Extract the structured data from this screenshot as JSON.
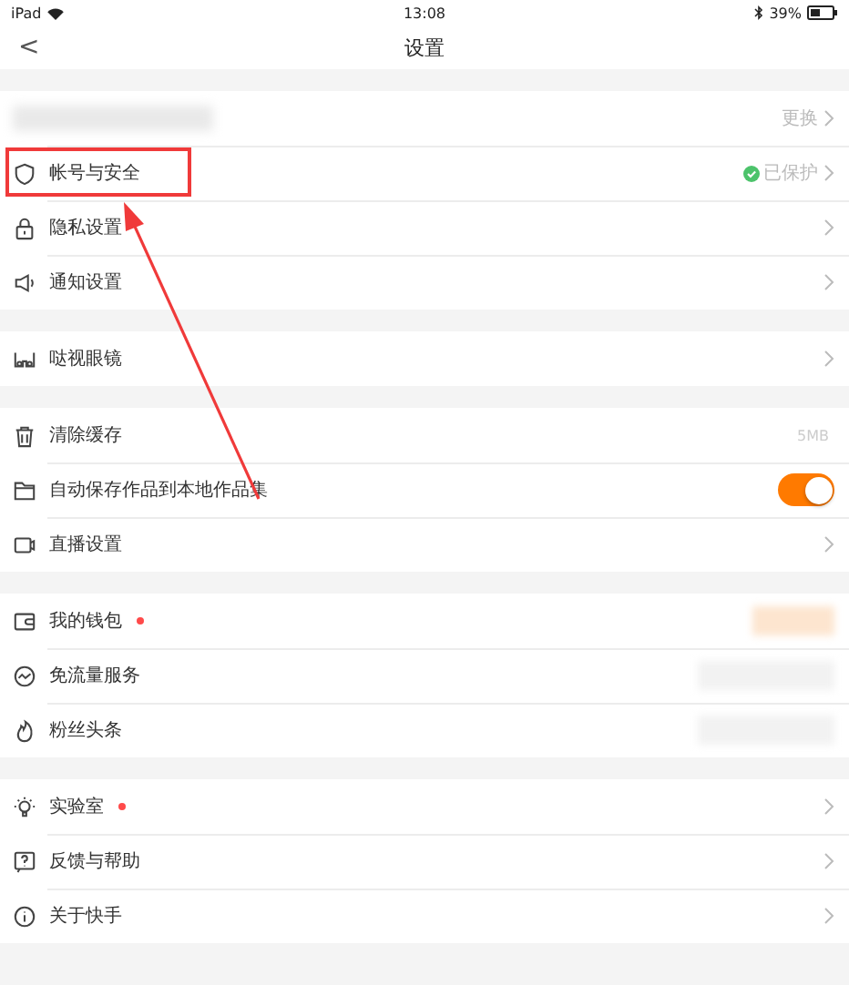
{
  "status_bar": {
    "device": "iPad",
    "time": "13:08",
    "battery": "39%"
  },
  "nav": {
    "back": "<",
    "title": "设置"
  },
  "sections": [
    {
      "rows": [
        {
          "kind": "profile",
          "label_hidden": true,
          "value": "更换",
          "chevron": true,
          "dot": false,
          "value_hidden": false,
          "annotated": false
        },
        {
          "kind": "link",
          "label": "帐号与安全",
          "value": "已保护",
          "verified": true,
          "chevron": true,
          "dot": false,
          "value_hidden": false,
          "annotated": true
        },
        {
          "kind": "link",
          "label": "隐私设置",
          "chevron": true,
          "dot": false,
          "value_hidden": false,
          "annotated": false
        },
        {
          "kind": "link",
          "label": "通知设置",
          "chevron": true,
          "dot": false,
          "value_hidden": false,
          "annotated": false
        }
      ]
    },
    {
      "rows": [
        {
          "kind": "link",
          "label": "哒视眼镜",
          "chevron": true,
          "dot": false,
          "value_hidden": false,
          "annotated": false
        }
      ]
    },
    {
      "rows": [
        {
          "kind": "link",
          "label": "清除缓存",
          "value": "5MB",
          "chevron": false,
          "dot": false,
          "value_hidden": false,
          "annotated": false
        },
        {
          "kind": "toggle",
          "label": "自动保存作品到本地作品集",
          "on": true,
          "chevron": false,
          "dot": false,
          "value_hidden": false,
          "annotated": false
        },
        {
          "kind": "link",
          "label": "直播设置",
          "chevron": true,
          "dot": false,
          "value_hidden": false,
          "annotated": false
        }
      ]
    },
    {
      "rows": [
        {
          "kind": "link",
          "label": "我的钱包",
          "chevron": false,
          "dot": true,
          "value_hidden": true,
          "annotated": false
        },
        {
          "kind": "link",
          "label": "免流量服务",
          "chevron": false,
          "dot": false,
          "value_hidden": true,
          "annotated": false
        },
        {
          "kind": "link",
          "label": "粉丝头条",
          "chevron": false,
          "dot": false,
          "value_hidden": true,
          "annotated": false
        }
      ]
    },
    {
      "rows": [
        {
          "kind": "link",
          "label": "实验室",
          "chevron": true,
          "dot": true,
          "value_hidden": false,
          "annotated": false
        },
        {
          "kind": "link",
          "label": "反馈与帮助",
          "chevron": true,
          "dot": false,
          "value_hidden": false,
          "annotated": false
        },
        {
          "kind": "link",
          "label": "关于快手",
          "chevron": true,
          "dot": false,
          "value_hidden": false,
          "annotated": false
        }
      ]
    }
  ]
}
